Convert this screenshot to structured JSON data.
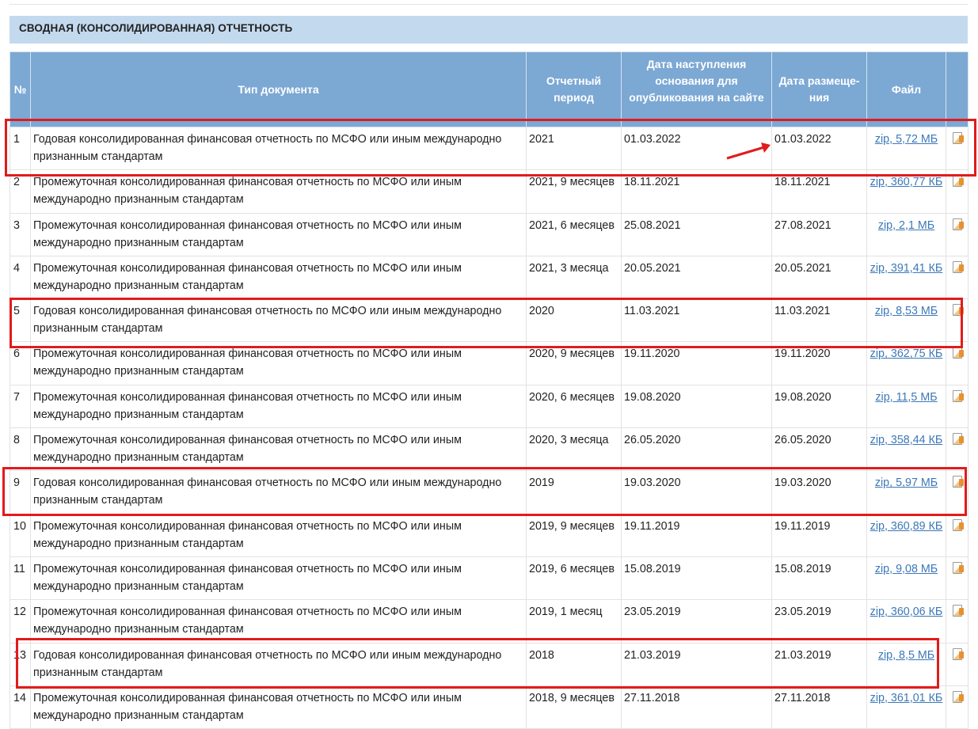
{
  "section": {
    "title": "СВОДНАЯ (КОНСОЛИДИРОВАННАЯ) ОТЧЕТНОСТЬ"
  },
  "table": {
    "headers": {
      "num": "№",
      "type": "Тип документа",
      "period": "Отчетный период",
      "basis_date": "Дата наступления основания для опубликования на сайте",
      "placement_date": "Дата размеще-ния",
      "file": "Файл"
    },
    "rows": [
      {
        "num": "1",
        "type": "Годовая консолидированная финансовая отчетность по МСФО или иным международно признанным стандартам",
        "period": "2021",
        "basis_date": "01.03.2022",
        "placement_date": "01.03.2022",
        "file": "zip, 5,72 МБ"
      },
      {
        "num": "2",
        "type": "Промежуточная консолидированная финансовая отчетность по МСФО или иным международно признанным стандартам",
        "period": "2021, 9 месяцев",
        "basis_date": "18.11.2021",
        "placement_date": "18.11.2021",
        "file": "zip, 360,77 КБ"
      },
      {
        "num": "3",
        "type": "Промежуточная консолидированная финансовая отчетность по МСФО или иным международно признанным стандартам",
        "period": "2021, 6 месяцев",
        "basis_date": "25.08.2021",
        "placement_date": "27.08.2021",
        "file": "zip, 2,1 МБ"
      },
      {
        "num": "4",
        "type": "Промежуточная консолидированная финансовая отчетность по МСФО или иным международно признанным стандартам",
        "period": "2021, 3 месяца",
        "basis_date": "20.05.2021",
        "placement_date": "20.05.2021",
        "file": "zip, 391,41 КБ"
      },
      {
        "num": "5",
        "type": "Годовая консолидированная финансовая отчетность по МСФО или иным международно признанным стандартам",
        "period": "2020",
        "basis_date": "11.03.2021",
        "placement_date": "11.03.2021",
        "file": "zip, 8,53 МБ"
      },
      {
        "num": "6",
        "type": "Промежуточная консолидированная финансовая отчетность по МСФО или иным международно признанным стандартам",
        "period": "2020, 9 месяцев",
        "basis_date": "19.11.2020",
        "placement_date": "19.11.2020",
        "file": "zip, 362,75 КБ"
      },
      {
        "num": "7",
        "type": "Промежуточная консолидированная финансовая отчетность по МСФО или иным международно признанным стандартам",
        "period": "2020, 6 месяцев",
        "basis_date": "19.08.2020",
        "placement_date": "19.08.2020",
        "file": "zip, 11,5 МБ"
      },
      {
        "num": "8",
        "type": "Промежуточная консолидированная финансовая отчетность по МСФО или иным международно признанным стандартам",
        "period": "2020, 3 месяца",
        "basis_date": "26.05.2020",
        "placement_date": "26.05.2020",
        "file": "zip, 358,44 КБ"
      },
      {
        "num": "9",
        "type": "Годовая консолидированная финансовая отчетность по МСФО или иным международно признанным стандартам",
        "period": "2019",
        "basis_date": "19.03.2020",
        "placement_date": "19.03.2020",
        "file": "zip, 5,97 МБ"
      },
      {
        "num": "10",
        "type": "Промежуточная консолидированная финансовая отчетность по МСФО или иным международно признанным стандартам",
        "period": "2019, 9 месяцев",
        "basis_date": "19.11.2019",
        "placement_date": "19.11.2019",
        "file": "zip, 360,89 КБ"
      },
      {
        "num": "11",
        "type": "Промежуточная консолидированная финансовая отчетность по МСФО или иным международно признанным стандартам",
        "period": "2019, 6 месяцев",
        "basis_date": "15.08.2019",
        "placement_date": "15.08.2019",
        "file": "zip, 9,08 МБ"
      },
      {
        "num": "12",
        "type": "Промежуточная консолидированная финансовая отчетность по МСФО или иным международно признанным стандартам",
        "period": "2019, 1 месяц",
        "basis_date": "23.05.2019",
        "placement_date": "23.05.2019",
        "file": "zip, 360,06 КБ"
      },
      {
        "num": "13",
        "type": "Годовая консолидированная финансовая отчетность по МСФО или иным международно признанным стандартам",
        "period": "2018",
        "basis_date": "21.03.2019",
        "placement_date": "21.03.2019",
        "file": "zip, 8,5 МБ"
      },
      {
        "num": "14",
        "type": "Промежуточная консолидированная финансовая отчетность по МСФО или иным международно признанным стандартам",
        "period": "2018, 9 месяцев",
        "basis_date": "27.11.2018",
        "placement_date": "27.11.2018",
        "file": "zip, 361,01 КБ"
      }
    ]
  },
  "annotations": {
    "highlight_color": "#e11b1b",
    "highlighted_rows": [
      "1",
      "5",
      "9",
      "13"
    ],
    "arrow_target": "placement_date"
  }
}
